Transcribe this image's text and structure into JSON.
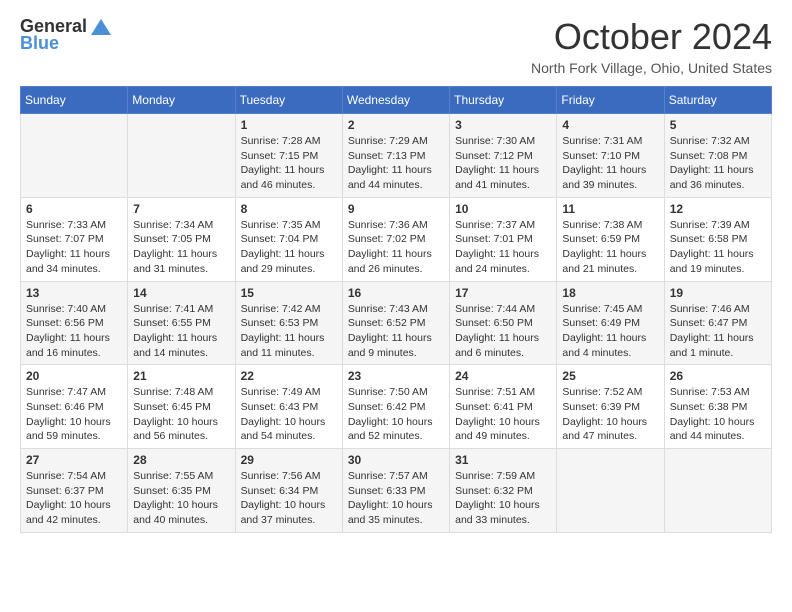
{
  "header": {
    "logo_general": "General",
    "logo_blue": "Blue",
    "title": "October 2024",
    "location": "North Fork Village, Ohio, United States"
  },
  "weekdays": [
    "Sunday",
    "Monday",
    "Tuesday",
    "Wednesday",
    "Thursday",
    "Friday",
    "Saturday"
  ],
  "weeks": [
    [
      {
        "day": "",
        "detail": ""
      },
      {
        "day": "",
        "detail": ""
      },
      {
        "day": "1",
        "detail": "Sunrise: 7:28 AM\nSunset: 7:15 PM\nDaylight: 11 hours and 46 minutes."
      },
      {
        "day": "2",
        "detail": "Sunrise: 7:29 AM\nSunset: 7:13 PM\nDaylight: 11 hours and 44 minutes."
      },
      {
        "day": "3",
        "detail": "Sunrise: 7:30 AM\nSunset: 7:12 PM\nDaylight: 11 hours and 41 minutes."
      },
      {
        "day": "4",
        "detail": "Sunrise: 7:31 AM\nSunset: 7:10 PM\nDaylight: 11 hours and 39 minutes."
      },
      {
        "day": "5",
        "detail": "Sunrise: 7:32 AM\nSunset: 7:08 PM\nDaylight: 11 hours and 36 minutes."
      }
    ],
    [
      {
        "day": "6",
        "detail": "Sunrise: 7:33 AM\nSunset: 7:07 PM\nDaylight: 11 hours and 34 minutes."
      },
      {
        "day": "7",
        "detail": "Sunrise: 7:34 AM\nSunset: 7:05 PM\nDaylight: 11 hours and 31 minutes."
      },
      {
        "day": "8",
        "detail": "Sunrise: 7:35 AM\nSunset: 7:04 PM\nDaylight: 11 hours and 29 minutes."
      },
      {
        "day": "9",
        "detail": "Sunrise: 7:36 AM\nSunset: 7:02 PM\nDaylight: 11 hours and 26 minutes."
      },
      {
        "day": "10",
        "detail": "Sunrise: 7:37 AM\nSunset: 7:01 PM\nDaylight: 11 hours and 24 minutes."
      },
      {
        "day": "11",
        "detail": "Sunrise: 7:38 AM\nSunset: 6:59 PM\nDaylight: 11 hours and 21 minutes."
      },
      {
        "day": "12",
        "detail": "Sunrise: 7:39 AM\nSunset: 6:58 PM\nDaylight: 11 hours and 19 minutes."
      }
    ],
    [
      {
        "day": "13",
        "detail": "Sunrise: 7:40 AM\nSunset: 6:56 PM\nDaylight: 11 hours and 16 minutes."
      },
      {
        "day": "14",
        "detail": "Sunrise: 7:41 AM\nSunset: 6:55 PM\nDaylight: 11 hours and 14 minutes."
      },
      {
        "day": "15",
        "detail": "Sunrise: 7:42 AM\nSunset: 6:53 PM\nDaylight: 11 hours and 11 minutes."
      },
      {
        "day": "16",
        "detail": "Sunrise: 7:43 AM\nSunset: 6:52 PM\nDaylight: 11 hours and 9 minutes."
      },
      {
        "day": "17",
        "detail": "Sunrise: 7:44 AM\nSunset: 6:50 PM\nDaylight: 11 hours and 6 minutes."
      },
      {
        "day": "18",
        "detail": "Sunrise: 7:45 AM\nSunset: 6:49 PM\nDaylight: 11 hours and 4 minutes."
      },
      {
        "day": "19",
        "detail": "Sunrise: 7:46 AM\nSunset: 6:47 PM\nDaylight: 11 hours and 1 minute."
      }
    ],
    [
      {
        "day": "20",
        "detail": "Sunrise: 7:47 AM\nSunset: 6:46 PM\nDaylight: 10 hours and 59 minutes."
      },
      {
        "day": "21",
        "detail": "Sunrise: 7:48 AM\nSunset: 6:45 PM\nDaylight: 10 hours and 56 minutes."
      },
      {
        "day": "22",
        "detail": "Sunrise: 7:49 AM\nSunset: 6:43 PM\nDaylight: 10 hours and 54 minutes."
      },
      {
        "day": "23",
        "detail": "Sunrise: 7:50 AM\nSunset: 6:42 PM\nDaylight: 10 hours and 52 minutes."
      },
      {
        "day": "24",
        "detail": "Sunrise: 7:51 AM\nSunset: 6:41 PM\nDaylight: 10 hours and 49 minutes."
      },
      {
        "day": "25",
        "detail": "Sunrise: 7:52 AM\nSunset: 6:39 PM\nDaylight: 10 hours and 47 minutes."
      },
      {
        "day": "26",
        "detail": "Sunrise: 7:53 AM\nSunset: 6:38 PM\nDaylight: 10 hours and 44 minutes."
      }
    ],
    [
      {
        "day": "27",
        "detail": "Sunrise: 7:54 AM\nSunset: 6:37 PM\nDaylight: 10 hours and 42 minutes."
      },
      {
        "day": "28",
        "detail": "Sunrise: 7:55 AM\nSunset: 6:35 PM\nDaylight: 10 hours and 40 minutes."
      },
      {
        "day": "29",
        "detail": "Sunrise: 7:56 AM\nSunset: 6:34 PM\nDaylight: 10 hours and 37 minutes."
      },
      {
        "day": "30",
        "detail": "Sunrise: 7:57 AM\nSunset: 6:33 PM\nDaylight: 10 hours and 35 minutes."
      },
      {
        "day": "31",
        "detail": "Sunrise: 7:59 AM\nSunset: 6:32 PM\nDaylight: 10 hours and 33 minutes."
      },
      {
        "day": "",
        "detail": ""
      },
      {
        "day": "",
        "detail": ""
      }
    ]
  ]
}
